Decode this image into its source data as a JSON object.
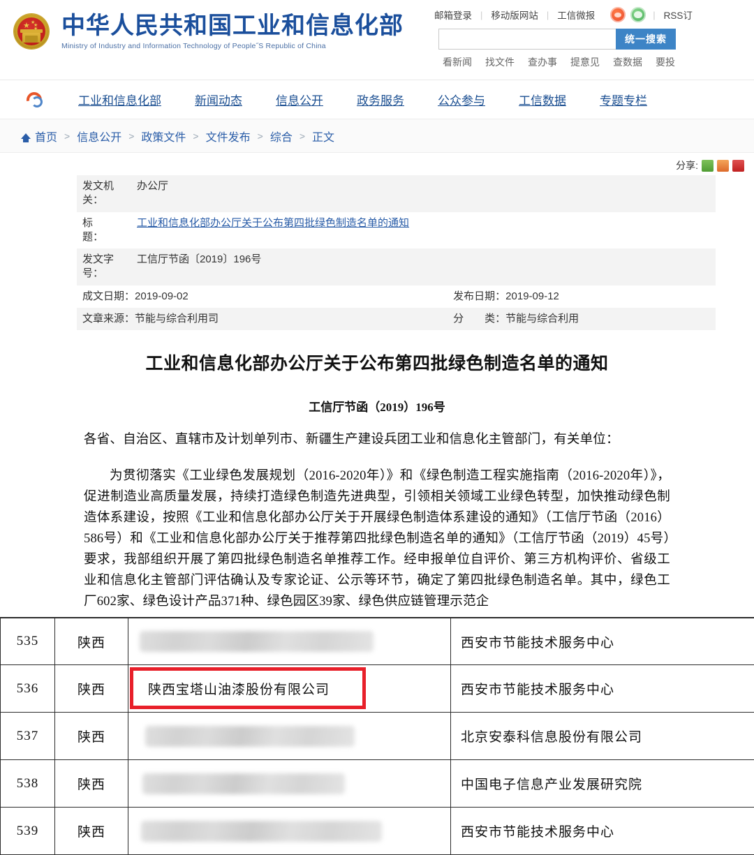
{
  "header": {
    "brand_cn": "中华人民共和国工业和信息化部",
    "brand_en": "Ministry of Industry and Information Technology of People˝S Republic of China",
    "emblem_icon": "national-emblem-icon",
    "top_links": [
      "邮箱登录",
      "移动版网站",
      "工信微报"
    ],
    "social_icons": [
      "weibo-icon",
      "wechat-icon"
    ],
    "rss_label": "RSS订",
    "search": {
      "value": "",
      "placeholder": "",
      "button_label": "统一搜索"
    },
    "quick_links": [
      "看新闻",
      "找文件",
      "查办事",
      "提意见",
      "查数据",
      "要投"
    ]
  },
  "nav": {
    "logo_icon": "miit-swirl-icon",
    "items": [
      "工业和信息化部",
      "新闻动态",
      "信息公开",
      "政务服务",
      "公众参与",
      "工信数据",
      "专题专栏"
    ]
  },
  "breadcrumb": {
    "home_icon": "home-icon",
    "items": [
      "首页",
      "信息公开",
      "政策文件",
      "文件发布",
      "综合",
      "正文"
    ],
    "separator": ">"
  },
  "share": {
    "label": "分享:",
    "icons": [
      "wechat-share-icon",
      "weibo-share-icon",
      "pdf-share-icon"
    ]
  },
  "meta": {
    "issuer_label": "发文机\n关：",
    "issuer_value": "办公厅",
    "title_label": "标\n题：",
    "title_value": "工业和信息化部办公厅关于公布第四批绿色制造名单的通知",
    "docnum_label": "发文字\n号：",
    "docnum_value": "工信厅节函〔2019〕196号",
    "written_label": "成文日期：",
    "written_value": "2019-09-02",
    "published_label": "发布日期：",
    "published_value": "2019-09-12",
    "source_label": "文章来源：",
    "source_value": "节能与综合利用司",
    "category_label": "分　　类：",
    "category_value": "节能与综合利用"
  },
  "document": {
    "title": "工业和信息化部办公厅关于公布第四批绿色制造名单的通知",
    "number": "工信厅节函（2019）196号",
    "salutation": "各省、自治区、直辖市及计划单列市、新疆生产建设兵团工业和信息化主管部门，有关单位：",
    "body": "为贯彻落实《工业绿色发展规划（2016-2020年）》和《绿色制造工程实施指南（2016-2020年）》，促进制造业高质量发展，持续打造绿色制造先进典型，引领相关领域工业绿色转型，加快推动绿色制造体系建设，按照《工业和信息化部办公厅关于开展绿色制造体系建设的通知》（工信厅节函（2016）586号）和《工业和信息化部办公厅关于推荐第四批绿色制造名单的通知》（工信厅节函（2019）45号）要求，我部组织开展了第四批绿色制造名单推荐工作。经申报单位自评价、第三方机构评价、省级工业和信息化主管部门评估确认及专家论证、公示等环节，确定了第四批绿色制造名单。其中，绿色工厂602家、绿色设计产品371种、绿色园区39家、绿色供应链管理示范企"
  },
  "list_table": {
    "highlight_color": "#e8202a",
    "rows": [
      {
        "no": "535",
        "province": "陕西",
        "name": "",
        "redacted": true,
        "org": "西安市节能技术服务中心",
        "highlighted": false
      },
      {
        "no": "536",
        "province": "陕西",
        "name": "陕西宝塔山油漆股份有限公司",
        "redacted": false,
        "org": "西安市节能技术服务中心",
        "highlighted": true
      },
      {
        "no": "537",
        "province": "陕西",
        "name": "",
        "redacted": true,
        "org": "北京安泰科信息股份有限公司",
        "highlighted": false
      },
      {
        "no": "538",
        "province": "陕西",
        "name": "",
        "redacted": true,
        "org": "中国电子信息产业发展研究院",
        "highlighted": false
      },
      {
        "no": "539",
        "province": "陕西",
        "name": "",
        "redacted": true,
        "org": "西安市节能技术服务中心",
        "highlighted": false
      }
    ]
  }
}
